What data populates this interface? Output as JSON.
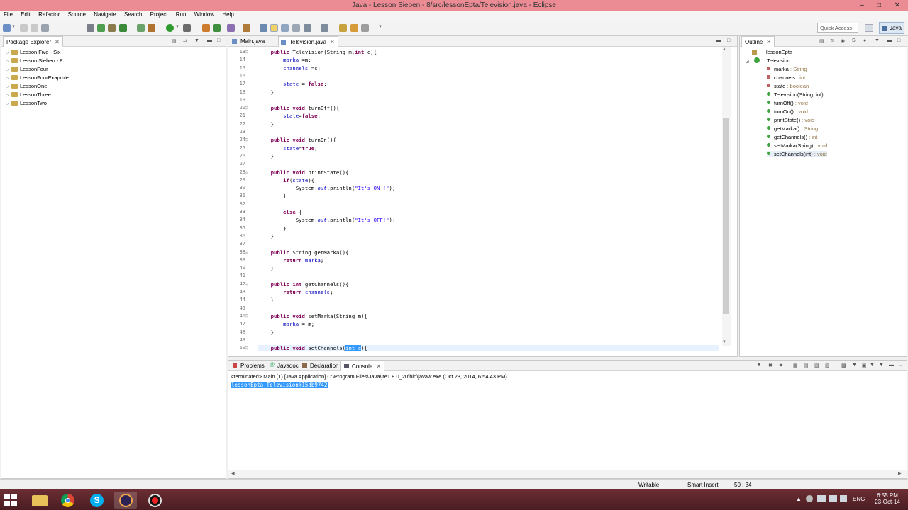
{
  "window": {
    "title": "Java - Lesson Sieben - 8/src/lessonEpta/Television.java - Eclipse"
  },
  "menu": [
    "File",
    "Edit",
    "Refactor",
    "Source",
    "Navigate",
    "Search",
    "Project",
    "Run",
    "Window",
    "Help"
  ],
  "toolbar": {
    "quick_access_placeholder": "Quick Access",
    "perspective": "Java"
  },
  "package_explorer": {
    "tab_label": "Package Explorer",
    "projects": [
      "Lesson Five - Six",
      "Lesson Sieben - 8",
      "LessonFour",
      "LessonFourExapmle",
      "LessonOne",
      "LessonThree",
      "LessonTwo"
    ]
  },
  "editor": {
    "tabs": [
      "Main.java",
      "Television.java"
    ],
    "active_tab": "Television.java",
    "lines": [
      {
        "n": "13",
        "code": "    public Television(String m,int c){"
      },
      {
        "n": "14",
        "code": "        marka =m;"
      },
      {
        "n": "15",
        "code": "        channels =c;"
      },
      {
        "n": "16",
        "code": ""
      },
      {
        "n": "17",
        "code": "        state = false;"
      },
      {
        "n": "18",
        "code": "    }"
      },
      {
        "n": "19",
        "code": ""
      },
      {
        "n": "20",
        "code": "    public void turnOff(){"
      },
      {
        "n": "21",
        "code": "        state=false;"
      },
      {
        "n": "22",
        "code": "    }"
      },
      {
        "n": "23",
        "code": ""
      },
      {
        "n": "24",
        "code": "    public void turnOn(){"
      },
      {
        "n": "25",
        "code": "        state=true;"
      },
      {
        "n": "26",
        "code": "    }"
      },
      {
        "n": "27",
        "code": ""
      },
      {
        "n": "28",
        "code": "    public void printState(){"
      },
      {
        "n": "29",
        "code": "        if(state){"
      },
      {
        "n": "30",
        "code": "            System.out.println(\"It's ON !\");"
      },
      {
        "n": "31",
        "code": "        }"
      },
      {
        "n": "32",
        "code": ""
      },
      {
        "n": "33",
        "code": "        else {"
      },
      {
        "n": "34",
        "code": "            System.out.println(\"It's OFF!\");"
      },
      {
        "n": "35",
        "code": "        }"
      },
      {
        "n": "36",
        "code": "    }"
      },
      {
        "n": "37",
        "code": ""
      },
      {
        "n": "38",
        "code": "    public String getMarka(){"
      },
      {
        "n": "39",
        "code": "        return marka;"
      },
      {
        "n": "40",
        "code": "    }"
      },
      {
        "n": "41",
        "code": ""
      },
      {
        "n": "42",
        "code": "    public int getChannels(){"
      },
      {
        "n": "43",
        "code": "        return channels;"
      },
      {
        "n": "44",
        "code": "    }"
      },
      {
        "n": "45",
        "code": ""
      },
      {
        "n": "46",
        "code": "    public void setMarka(String m){"
      },
      {
        "n": "47",
        "code": "        marka = m;"
      },
      {
        "n": "48",
        "code": "    }"
      },
      {
        "n": "49",
        "code": ""
      },
      {
        "n": "50",
        "code": "    public void setChannels(int c){"
      }
    ]
  },
  "outline": {
    "tab_label": "Outline",
    "package": "lessonEpta",
    "class": "Television",
    "members": [
      {
        "name": "marka",
        "type": " : String",
        "kind": "field"
      },
      {
        "name": "channels",
        "type": " : int",
        "kind": "field"
      },
      {
        "name": "state",
        "type": " : boolean",
        "kind": "field"
      },
      {
        "name": "Television(String, int)",
        "type": "",
        "kind": "ctor"
      },
      {
        "name": "turnOff()",
        "type": " : void",
        "kind": "method"
      },
      {
        "name": "turnOn()",
        "type": " : void",
        "kind": "method"
      },
      {
        "name": "printState()",
        "type": " : void",
        "kind": "method"
      },
      {
        "name": "getMarka()",
        "type": " : String",
        "kind": "method"
      },
      {
        "name": "getChannels()",
        "type": " : int",
        "kind": "method"
      },
      {
        "name": "setMarka(String)",
        "type": " : void",
        "kind": "method"
      },
      {
        "name": "setChannels(int)",
        "type": " : void",
        "kind": "method"
      }
    ]
  },
  "bottom": {
    "tabs": [
      "Problems",
      "Javadoc",
      "Declaration",
      "Console"
    ],
    "active_tab": "Console",
    "console_header": "<terminated> Main (1) [Java Application] C:\\Program Files\\Java\\jre1.8.0_20\\bin\\javaw.exe (Oct 23, 2014, 6:54:43 PM)",
    "console_output": "lessonEpta.Television@15db9742"
  },
  "status": {
    "writable": "Writable",
    "insert_mode": "Smart Insert",
    "position": "50 : 34"
  },
  "taskbar": {
    "lang": "ENG",
    "time": "6:55 PM",
    "date": "23-Oct-14"
  },
  "colors": {
    "titlebar": "#eb8c95",
    "selection": "#3399ff",
    "keyword": "#7f0055",
    "field": "#0000c0",
    "string": "#2a00ff"
  }
}
